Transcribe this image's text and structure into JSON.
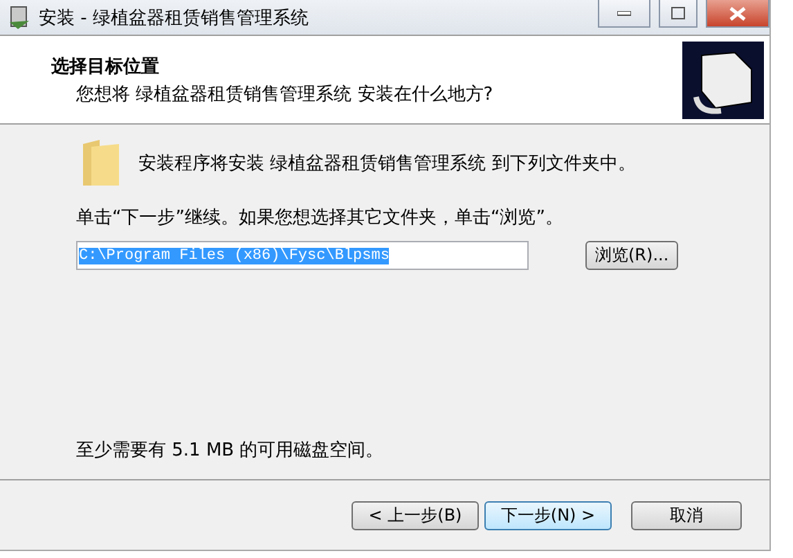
{
  "window": {
    "title": "安装 - 绿植盆器租赁销售管理系统"
  },
  "header": {
    "title": "选择目标位置",
    "subtitle": "您想将 绿植盆器租赁销售管理系统 安装在什么地方?"
  },
  "body": {
    "intro": "安装程序将安装 绿植盆器租赁销售管理系统 到下列文件夹中。",
    "instruction": "单击“下一步”继续。如果您想选择其它文件夹，单击“浏览”。",
    "path": "C:\\Program Files (x86)\\Fysc\\Blpsms",
    "path_selected": true,
    "browse": "浏览(R)...",
    "space": "至少需要有 5.1 MB 的可用磁盘空间。"
  },
  "buttons": [
    {
      "label": "< 上一步(B)",
      "kind": "back",
      "selected": false
    },
    {
      "label": "下一步(N) >",
      "kind": "next",
      "selected": true
    },
    {
      "label": "取消",
      "kind": "cancel",
      "selected": false
    }
  ]
}
